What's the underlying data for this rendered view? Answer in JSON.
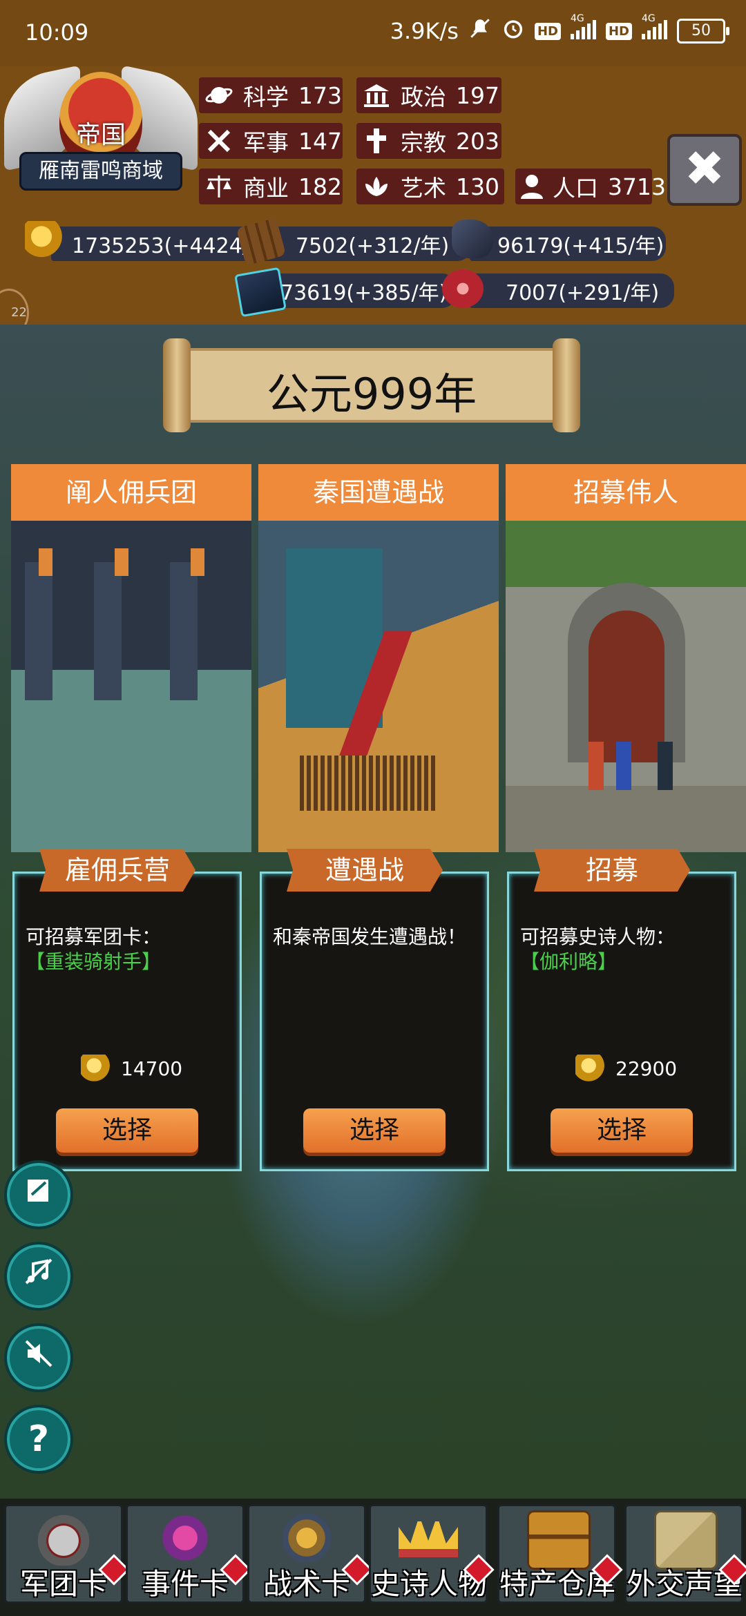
{
  "status_bar": {
    "time": "10:09",
    "net_speed": "3.9K/s",
    "hd1": "HD",
    "net1": "4G",
    "hd2": "HD",
    "net2": "4G",
    "battery": "50"
  },
  "realm": {
    "empire_label": "帝国",
    "realm_name": "雁南雷鸣商域"
  },
  "stats": [
    {
      "label": "科学",
      "value": "173",
      "icon": "planet-icon"
    },
    {
      "label": "政治",
      "value": "197",
      "icon": "temple-icon"
    },
    {
      "label": "军事",
      "value": "147",
      "icon": "crossed-swords-icon"
    },
    {
      "label": "宗教",
      "value": "203",
      "icon": "cross-icon"
    },
    {
      "label": "商业",
      "value": "182",
      "icon": "scales-icon"
    },
    {
      "label": "艺术",
      "value": "130",
      "icon": "lotus-icon"
    },
    {
      "label": "人口",
      "value": "3713",
      "icon": "person-icon"
    }
  ],
  "resources": {
    "gold": "1735253(+4424/年",
    "wood": "7502(+312/年)",
    "stone": "96179(+415/年)",
    "iron": "73619(+385/年)",
    "meat": "7007(+291/年)"
  },
  "side_bubble": "22",
  "year_banner": "公元999年",
  "cards": [
    {
      "title": "阐人佣兵团",
      "tab": "雇佣兵营",
      "desc_prefix": "可招募军团卡：",
      "desc_highlight": "【重装骑射手】",
      "cost": "14700",
      "button": "选择"
    },
    {
      "title": "秦国遭遇战",
      "tab": "遭遇战",
      "desc_prefix": "和秦帝国发生遭遇战！",
      "desc_highlight": "",
      "cost": "",
      "button": "选择"
    },
    {
      "title": "招募伟人",
      "tab": "招募",
      "desc_prefix": "可招募史诗人物：",
      "desc_highlight": "【伽利略】",
      "cost": "22900",
      "button": "选择"
    }
  ],
  "side_buttons": [
    "book-icon",
    "music-off-icon",
    "sound-off-icon",
    "help-icon"
  ],
  "help_glyph": "?",
  "bottom_nav": [
    {
      "label": "军团卡",
      "icon": "helmet-icon"
    },
    {
      "label": "事件卡",
      "icon": "scroll-icon"
    },
    {
      "label": "战术卡",
      "icon": "shield-emblem-icon"
    },
    {
      "label": "史诗人物",
      "icon": "crown-icon"
    },
    {
      "label": "特产仓库",
      "icon": "treasure-chest-icon"
    },
    {
      "label": "外交声望",
      "icon": "envelope-icon"
    }
  ],
  "colors": {
    "top_panel": "#7a4d14",
    "stat_bg": "#5a1d1a",
    "card_header": "#ef8a3a",
    "panel_border": "#88d8db",
    "highlight_text": "#4bd04b",
    "button": "#e2702a"
  }
}
